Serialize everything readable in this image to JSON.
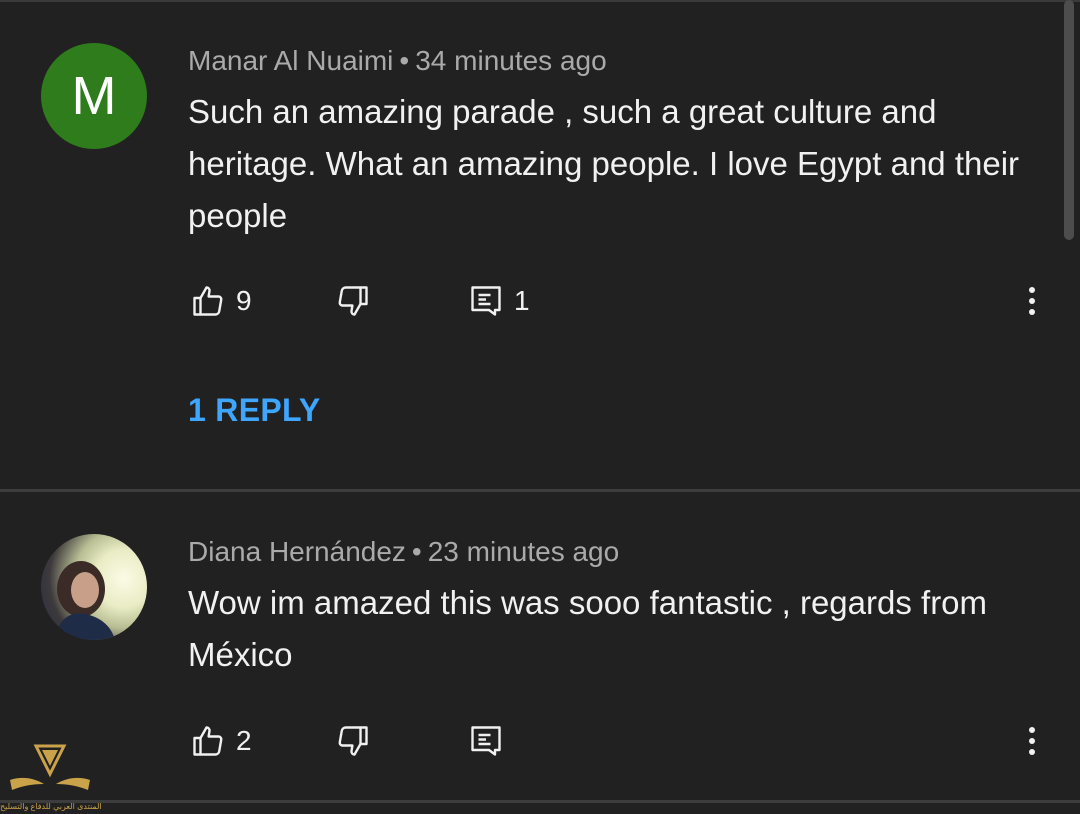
{
  "comments": [
    {
      "avatar_letter": "M",
      "author": "Manar Al Nuaimi",
      "separator": "•",
      "time": "34 minutes ago",
      "text": "Such an amazing parade , such a great culture and heritage. What an amazing people. I love Egypt and their people",
      "likes": "9",
      "replies_count": "1",
      "reply_link": "1 REPLY",
      "avatar_color": "#2f7c1c"
    },
    {
      "author": "Diana Hernández",
      "separator": "•",
      "time": "23 minutes ago",
      "text": "Wow im amazed  this was sooo fantastic , regards from México",
      "likes": "2"
    }
  ],
  "icons": {
    "like": "thumbs-up-icon",
    "dislike": "thumbs-down-icon",
    "reply": "comment-icon",
    "more": "more-vert-icon"
  },
  "colors": {
    "background": "#212121",
    "link": "#3ea6ff",
    "meta": "#aaaaaa",
    "text": "#f1f1f1"
  },
  "watermark": {
    "text": "المنتدى العربي للدفاع والتسليح"
  }
}
